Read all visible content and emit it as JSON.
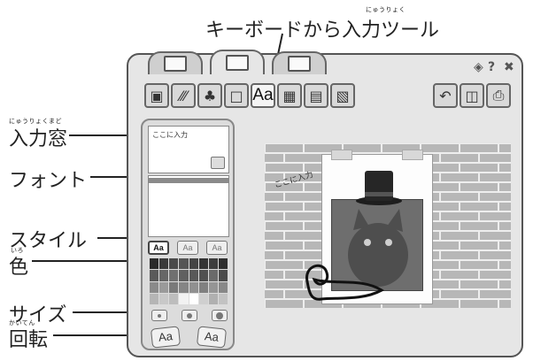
{
  "callouts": {
    "top": {
      "furigana": "にゅうりょく",
      "label": "キーボードから入力ツール"
    },
    "input_window": {
      "furigana": "にゅうりょくまど",
      "label": "入力窓"
    },
    "font": {
      "label": "フォント"
    },
    "style": {
      "label": "スタイル"
    },
    "color": {
      "furigana": "いろ",
      "label": "色"
    },
    "size": {
      "label": "サイズ"
    },
    "rotate": {
      "furigana": "かいてん",
      "label": "回転"
    }
  },
  "window": {
    "tabs": [
      {
        "icon": "stamp-tab-icon"
      },
      {
        "icon": "canvas-tab-icon",
        "active": true
      },
      {
        "icon": "photo-tab-icon"
      }
    ],
    "controls": {
      "settings": "◈",
      "help": "?",
      "close": "✖"
    }
  },
  "toolbar": {
    "tools": [
      {
        "name": "photo-tool",
        "glyph": "▣"
      },
      {
        "name": "pencil-tool",
        "glyph": "⁄⁄⁄"
      },
      {
        "name": "stamp-tool",
        "glyph": "♣"
      },
      {
        "name": "frame-tool",
        "glyph": "□"
      },
      {
        "name": "text-tool",
        "glyph": "Aa"
      },
      {
        "name": "filter-tool",
        "glyph": "▦"
      },
      {
        "name": "background-tool",
        "glyph": "▤"
      },
      {
        "name": "scene-tool",
        "glyph": "▧"
      }
    ],
    "actions": [
      {
        "name": "undo-button",
        "glyph": "↶"
      },
      {
        "name": "clear-button",
        "glyph": "◫"
      },
      {
        "name": "print-button",
        "glyph": "⎙"
      }
    ]
  },
  "text_panel": {
    "input_value": "ここに入力",
    "style_buttons": [
      "Aa",
      "Aa",
      "Aa"
    ],
    "rotate_buttons": [
      "Aa",
      "Aa"
    ],
    "palette": [
      "#2a2a2a",
      "#3a3a3a",
      "#4a4a4a",
      "#555555",
      "#444444",
      "#333333",
      "#3d3d3d",
      "#2f2f2f",
      "#5a5a5a",
      "#666666",
      "#707070",
      "#606060",
      "#585858",
      "#505050",
      "#6a6a6a",
      "#4c4c4c",
      "#8a8a8a",
      "#9a9a9a",
      "#7a7a7a",
      "#858585",
      "#909090",
      "#808080",
      "#959595",
      "#888888",
      "#b5b5b5",
      "#c8c8c8",
      "#bdbdbd",
      "#f2f2f2",
      "#ffffff",
      "#cfcfcf",
      "#b0b0b0",
      "#c2c2c2"
    ]
  },
  "canvas": {
    "overlay_text": "ここに入力"
  },
  "colors": {
    "window_bg": "#e6e6e6",
    "brick": "#b7b7b7",
    "mortar": "#eeeeee"
  }
}
